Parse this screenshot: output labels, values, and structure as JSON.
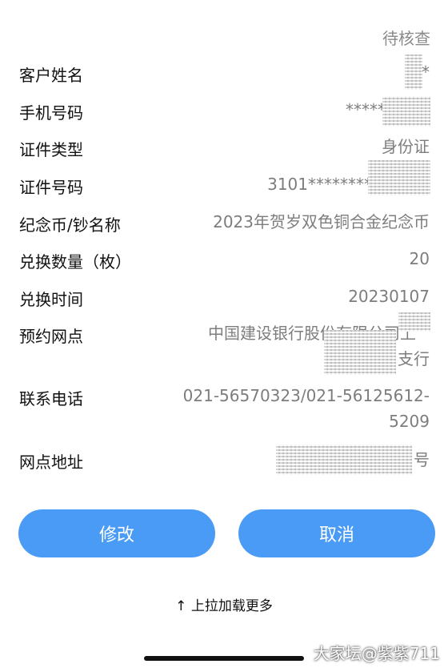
{
  "status": "待核查",
  "fields": [
    {
      "label": "客户姓名",
      "value": "*"
    },
    {
      "label": "手机号码",
      "value": "*****"
    },
    {
      "label": "证件类型",
      "value": "身份证"
    },
    {
      "label": "证件号码",
      "value": "3101********"
    },
    {
      "label": "纪念币/钞名称",
      "value": "2023年贺岁双色铜合金纪念币"
    },
    {
      "label": "兑换数量（枚）",
      "value": "20"
    },
    {
      "label": "兑换时间",
      "value": "20230107"
    },
    {
      "label": "预约网点",
      "value_line1": "中国建设银行股份有限公司上",
      "value_line2": "支行"
    },
    {
      "label": "联系电话",
      "value_line1": "021-56570323/021-56125612-",
      "value_line2": "5209"
    },
    {
      "label": "网点地址",
      "value": "号"
    }
  ],
  "buttons": {
    "modify": "修改",
    "cancel": "取消"
  },
  "pull_hint": "上拉加载更多",
  "watermark": "大家坛@紫紫711",
  "colors": {
    "accent": "#4a9bf5",
    "label": "#111111",
    "value": "#7d7d7d"
  }
}
